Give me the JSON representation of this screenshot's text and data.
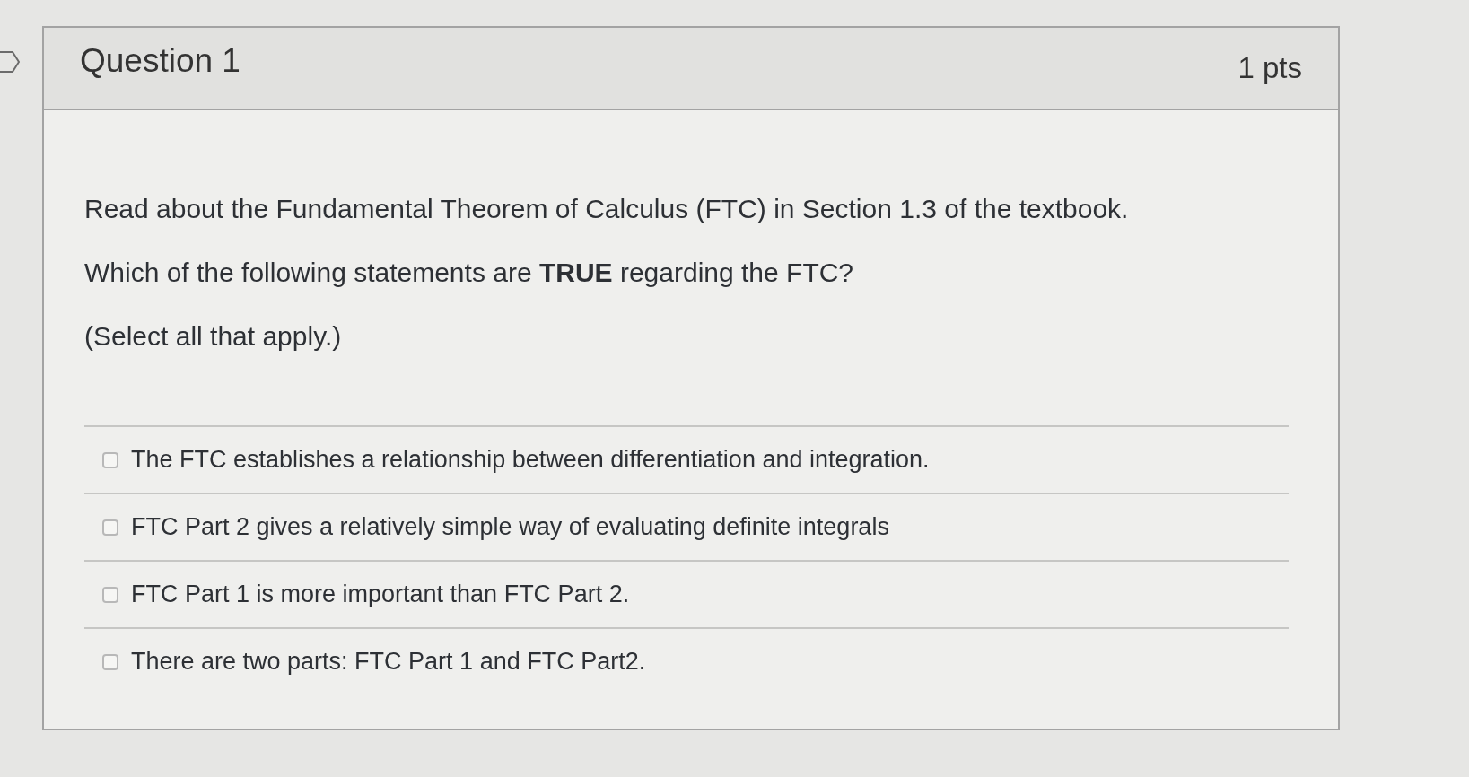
{
  "question": {
    "title": "Question 1",
    "points": "1 pts"
  },
  "prompt": [
    "Read about the Fundamental Theorem of Calculus (FTC) in Section 1.3 of the textbook.",
    "Which of the following statements are **TRUE** regarding the FTC?",
    "(Select all that apply.)"
  ],
  "answers": [
    {
      "label": "The FTC establishes a relationship between differentiation and integration.",
      "checked": false
    },
    {
      "label": "FTC Part 2 gives a relatively simple way of evaluating definite integrals",
      "checked": false
    },
    {
      "label": "FTC Part 1 is more important than FTC Part 2.",
      "checked": false
    },
    {
      "label": "There are two parts: FTC Part 1 and FTC Part2.",
      "checked": false
    }
  ]
}
